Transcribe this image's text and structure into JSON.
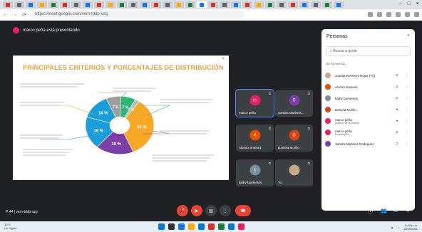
{
  "browser": {
    "tab_colors": [
      "#d93025",
      "#5f6368",
      "#1a73e8",
      "#f9ab00",
      "#188038",
      "#d93025",
      "#5f6368",
      "#1a73e8",
      "#d93025",
      "#f9ab00",
      "#188038",
      "#5f6368",
      "#1a73e8",
      "#d93025",
      "#5f6368",
      "#f9ab00",
      "#188038",
      "#1a73e8",
      "#d93025",
      "#5f6368",
      "#1a73e8",
      "#d93025",
      "#f9ab00",
      "#188038",
      "#5f6368",
      "#d93025",
      "#1a73e8",
      "#5f6368",
      "#188038",
      "#1a73e8"
    ],
    "url": "https://meet.google.com/vem-tddp-vzg"
  },
  "meeting": {
    "presenter_label": "marco peña está presentando",
    "code": "P:44 | vem-tddp-vzg"
  },
  "slide": {
    "title": "PRINCIPALES CRITERIOS Y PORCENTAJES DE DISTRIBUCIÓN",
    "close_glyph": "×"
  },
  "chart_data": {
    "type": "pie",
    "title": "",
    "slices": [
      {
        "label": "34 %",
        "value": 34,
        "color": "#f7a825"
      },
      {
        "label": "18 %",
        "value": 18,
        "color": "#7b3fa5"
      },
      {
        "label": "18 %",
        "value": 18,
        "color": "#1a9ed9"
      },
      {
        "label": "14 %",
        "value": 14,
        "color": "#1a9ed9"
      },
      {
        "label": "7 %",
        "value": 7,
        "color": "#9e9e9e"
      },
      {
        "label": "7 %",
        "value": 7,
        "color": "#2bb673"
      },
      {
        "label": "2 %",
        "value": 2,
        "color": "#b0bec5"
      }
    ]
  },
  "tiles": [
    {
      "name": "marco peña",
      "initial": "m",
      "color": "#e91e63"
    },
    {
      "name": "Sandra Marlenis...",
      "initial": "S",
      "color": "#7b3fa5"
    },
    {
      "name": "Alonso Jimenez",
      "initial": "A",
      "color": "#e65100"
    },
    {
      "name": "Daniela Murillo",
      "initial": "D",
      "color": "#d84315"
    },
    {
      "name": "kathy barrientos",
      "initial": "k",
      "color": "#78909c"
    },
    {
      "name": "Yo",
      "initial": "",
      "color": "#c8a98a"
    }
  ],
  "panel": {
    "title": "Personas",
    "close_glyph": "×",
    "search_placeholder": "Buscar a gente",
    "section": "En la reunión",
    "people": [
      {
        "name": "Juanita Rosmery Rojas (Tú)",
        "sub": "",
        "color": "#c8a98a"
      },
      {
        "name": "Alonso Jimenez",
        "sub": "",
        "color": "#e65100"
      },
      {
        "name": "kathy barrientos",
        "sub": "",
        "color": "#78909c"
      },
      {
        "name": "Daniela Murillo",
        "sub": "",
        "color": "#d84315"
      },
      {
        "name": "marco peña",
        "sub": "Anfitrión de la reunión",
        "color": "#e91e63"
      },
      {
        "name": "marco peña",
        "sub": "Presentación",
        "color": "#e91e63"
      },
      {
        "name": "Sandra Marlenis Rodriguez",
        "sub": "",
        "color": "#7b3fa5"
      }
    ]
  },
  "controls": {
    "mic_glyph": "🎤",
    "cam_glyph": "▶",
    "cc_glyph": "▤",
    "more_glyph": "⋮",
    "end_glyph": "☎"
  },
  "taskbar": {
    "weather_temp": "19°C",
    "weather_desc": "Llu. ligera",
    "time": "8:44 p. m.",
    "date": "16/09/2021",
    "app_colors": [
      "#0078d4",
      "#333333",
      "#1a73e8",
      "#f9ab00",
      "#0078d4",
      "#d93025",
      "#188038",
      "#0078d4",
      "#e91e63"
    ]
  }
}
